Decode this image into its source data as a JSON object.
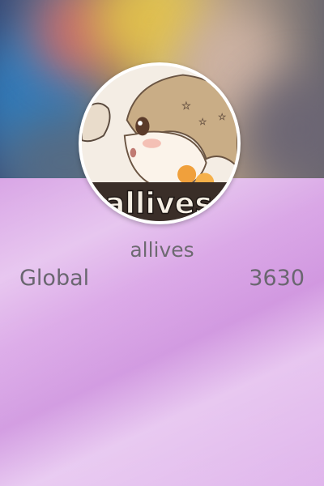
{
  "profile": {
    "avatar_text": "allives",
    "username": "allives"
  },
  "ranking": {
    "label": "Global",
    "value": "3630"
  }
}
